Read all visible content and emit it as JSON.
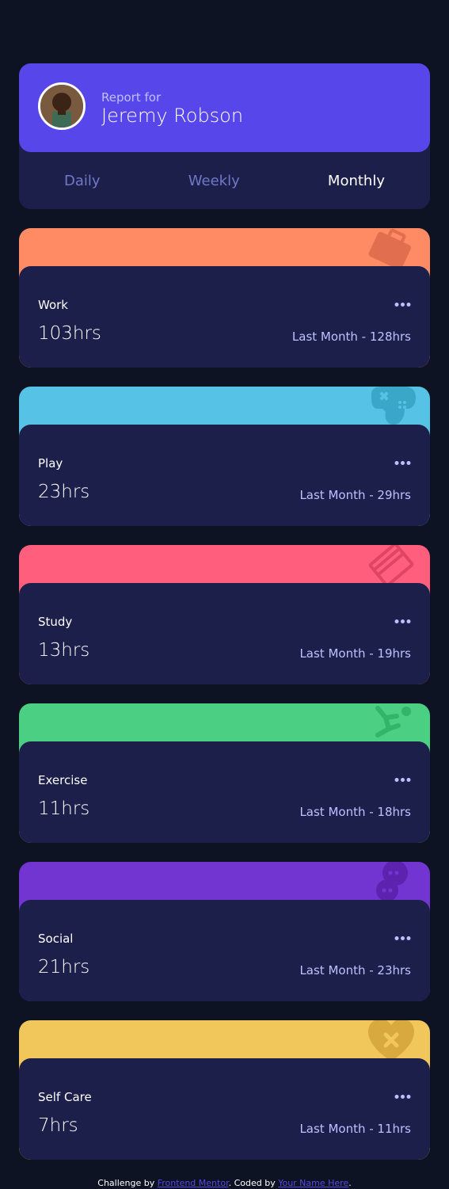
{
  "profile": {
    "report_label": "Report for",
    "name": "Jeremy Robson"
  },
  "tabs": [
    {
      "label": "Daily",
      "active": false
    },
    {
      "label": "Weekly",
      "active": false
    },
    {
      "label": "Monthly",
      "active": true
    }
  ],
  "activities": [
    {
      "title": "Work",
      "hours": "103hrs",
      "previous": "Last Month - 128hrs",
      "color": "#ff8b64",
      "icon_color": "#e06e4f",
      "icon": "briefcase-icon"
    },
    {
      "title": "Play",
      "hours": "23hrs",
      "previous": "Last Month - 29hrs",
      "color": "#55c2e6",
      "icon_color": "#3aa7c9",
      "icon": "gamepad-icon"
    },
    {
      "title": "Study",
      "hours": "13hrs",
      "previous": "Last Month - 19hrs",
      "color": "#ff5e7d",
      "icon_color": "#e04463",
      "icon": "book-icon"
    },
    {
      "title": "Exercise",
      "hours": "11hrs",
      "previous": "Last Month - 18hrs",
      "color": "#4bcf82",
      "icon_color": "#34b36a",
      "icon": "running-icon"
    },
    {
      "title": "Social",
      "hours": "21hrs",
      "previous": "Last Month - 23hrs",
      "color": "#7335d2",
      "icon_color": "#5b23ae",
      "icon": "chat-icon"
    },
    {
      "title": "Self Care",
      "hours": "7hrs",
      "previous": "Last Month - 11hrs",
      "color": "#f1c75b",
      "icon_color": "#d7a93f",
      "icon": "heart-icon"
    }
  ],
  "footer": {
    "prefix": "Challenge by ",
    "link1": "Frontend Mentor",
    "middle": ". Coded by ",
    "link2": "Your Name Here",
    "suffix": "."
  }
}
